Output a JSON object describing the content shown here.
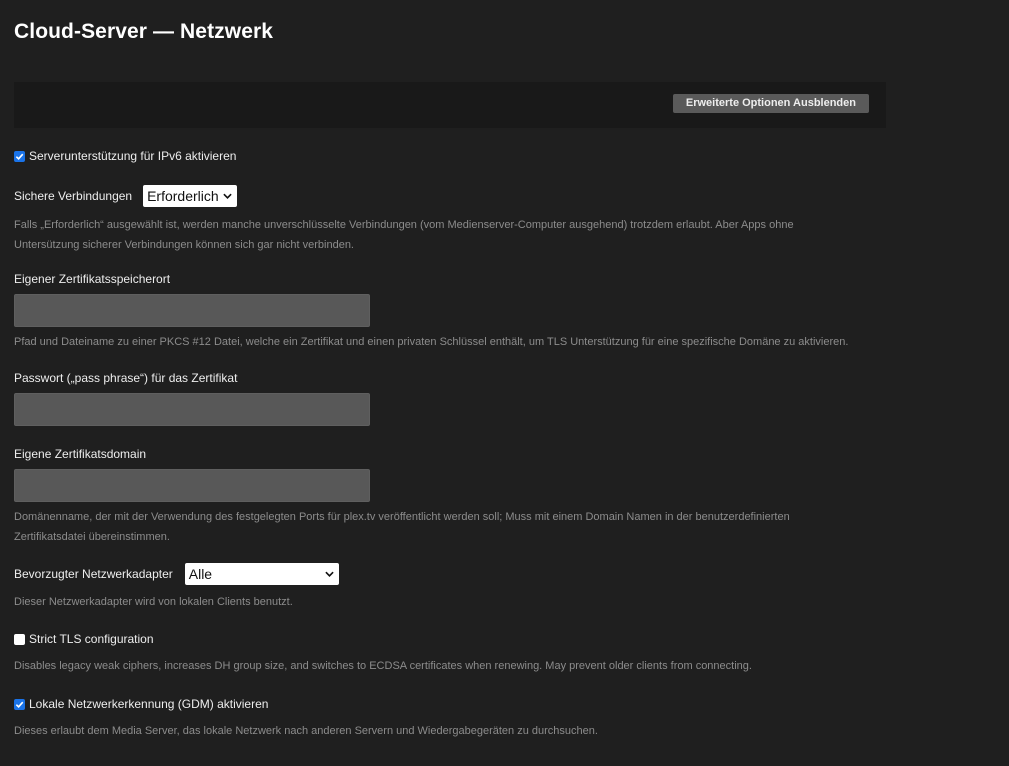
{
  "page": {
    "title": "Cloud-Server — Netzwerk"
  },
  "toolbar": {
    "advanced_toggle_label": "Erweiterte Optionen Ausblenden"
  },
  "settings": {
    "ipv6": {
      "checked": true,
      "label": "Serverunterstützung für IPv6 aktivieren"
    },
    "secure_connections": {
      "label": "Sichere Verbindungen",
      "selected": "Erforderlich",
      "help": "Falls „Erforderlich“ ausgewählt ist, werden manche unverschlüsselte Verbindungen (vom Medienserver-Computer ausgehend) trotzdem erlaubt. Aber Apps ohne Untersützung sicherer Verbindungen können sich gar nicht verbinden."
    },
    "cert_path": {
      "label": "Eigener Zertifikatsspeicherort",
      "value": "",
      "help": "Pfad und Dateiname zu einer PKCS #12 Datei, welche ein Zertifikat und einen privaten Schlüssel enthält, um TLS Unterstützung für eine spezifische Domäne zu aktivieren."
    },
    "cert_password": {
      "label": "Passwort („pass phrase“) für das Zertifikat",
      "value": ""
    },
    "cert_domain": {
      "label": "Eigene Zertifikatsdomain",
      "value": "",
      "help": "Domänenname, der mit der Verwendung des festgelegten Ports für plex.tv veröffentlicht werden soll; Muss mit einem Domain Namen in der benutzerdefinierten Zertifikatsdatei übereinstimmen."
    },
    "network_adapter": {
      "label": "Bevorzugter Netzwerkadapter",
      "selected": "Alle",
      "help": "Dieser Netzwerkadapter wird von lokalen Clients benutzt."
    },
    "strict_tls": {
      "checked": false,
      "label": "Strict TLS configuration",
      "help": "Disables legacy weak ciphers, increases DH group size, and switches to ECDSA certificates when renewing. May prevent older clients from connecting."
    },
    "gdm": {
      "checked": true,
      "label": "Lokale Netzwerkerkennung (GDM) aktivieren",
      "help": "Dieses erlaubt dem Media Server, das lokale Netzwerk nach anderen Servern und Wiedergabegeräten zu durchsuchen."
    }
  },
  "colors": {
    "background": "#1f1f1f",
    "toolbar": "#191919",
    "input": "#585858",
    "checkbox_accent": "#1a73e8",
    "help_text": "#8c8c8c"
  },
  "icons": {
    "checkbox_checked": "checkmark-icon",
    "select_arrow": "chevron-down-icon"
  }
}
